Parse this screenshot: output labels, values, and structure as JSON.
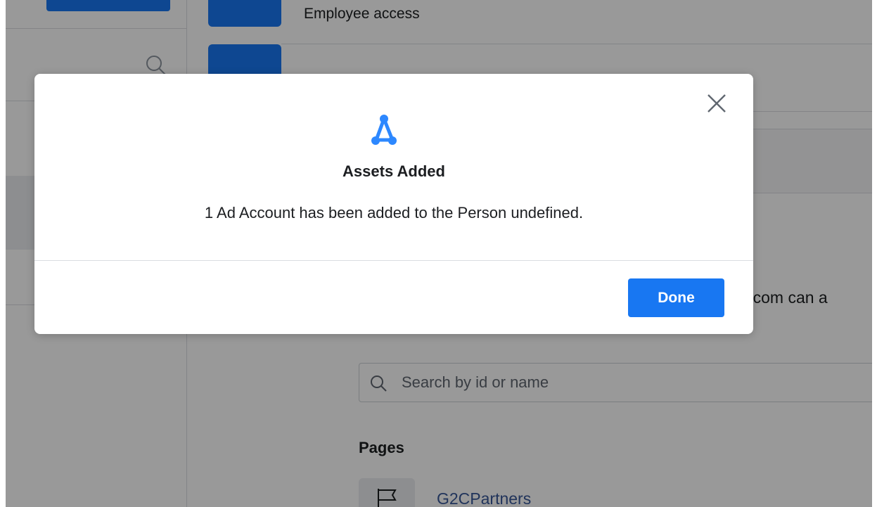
{
  "background": {
    "rows": [
      {
        "label": "Employee access"
      },
      {
        "label": ""
      }
    ],
    "description_fragment": "il.com can a",
    "search": {
      "placeholder": "Search by id or name"
    },
    "section_title": "Pages",
    "page_item": {
      "name": "G2CPartners"
    }
  },
  "modal": {
    "title": "Assets Added",
    "message": "1 Ad Account has been added to the Person undefined.",
    "done_label": "Done",
    "close_icon": "close-icon",
    "asset_icon": "asset-network-icon"
  },
  "colors": {
    "primary": "#1877f2",
    "overlay": "rgba(0,0,0,0.4)",
    "link": "#385898",
    "text": "#1c1e21"
  }
}
